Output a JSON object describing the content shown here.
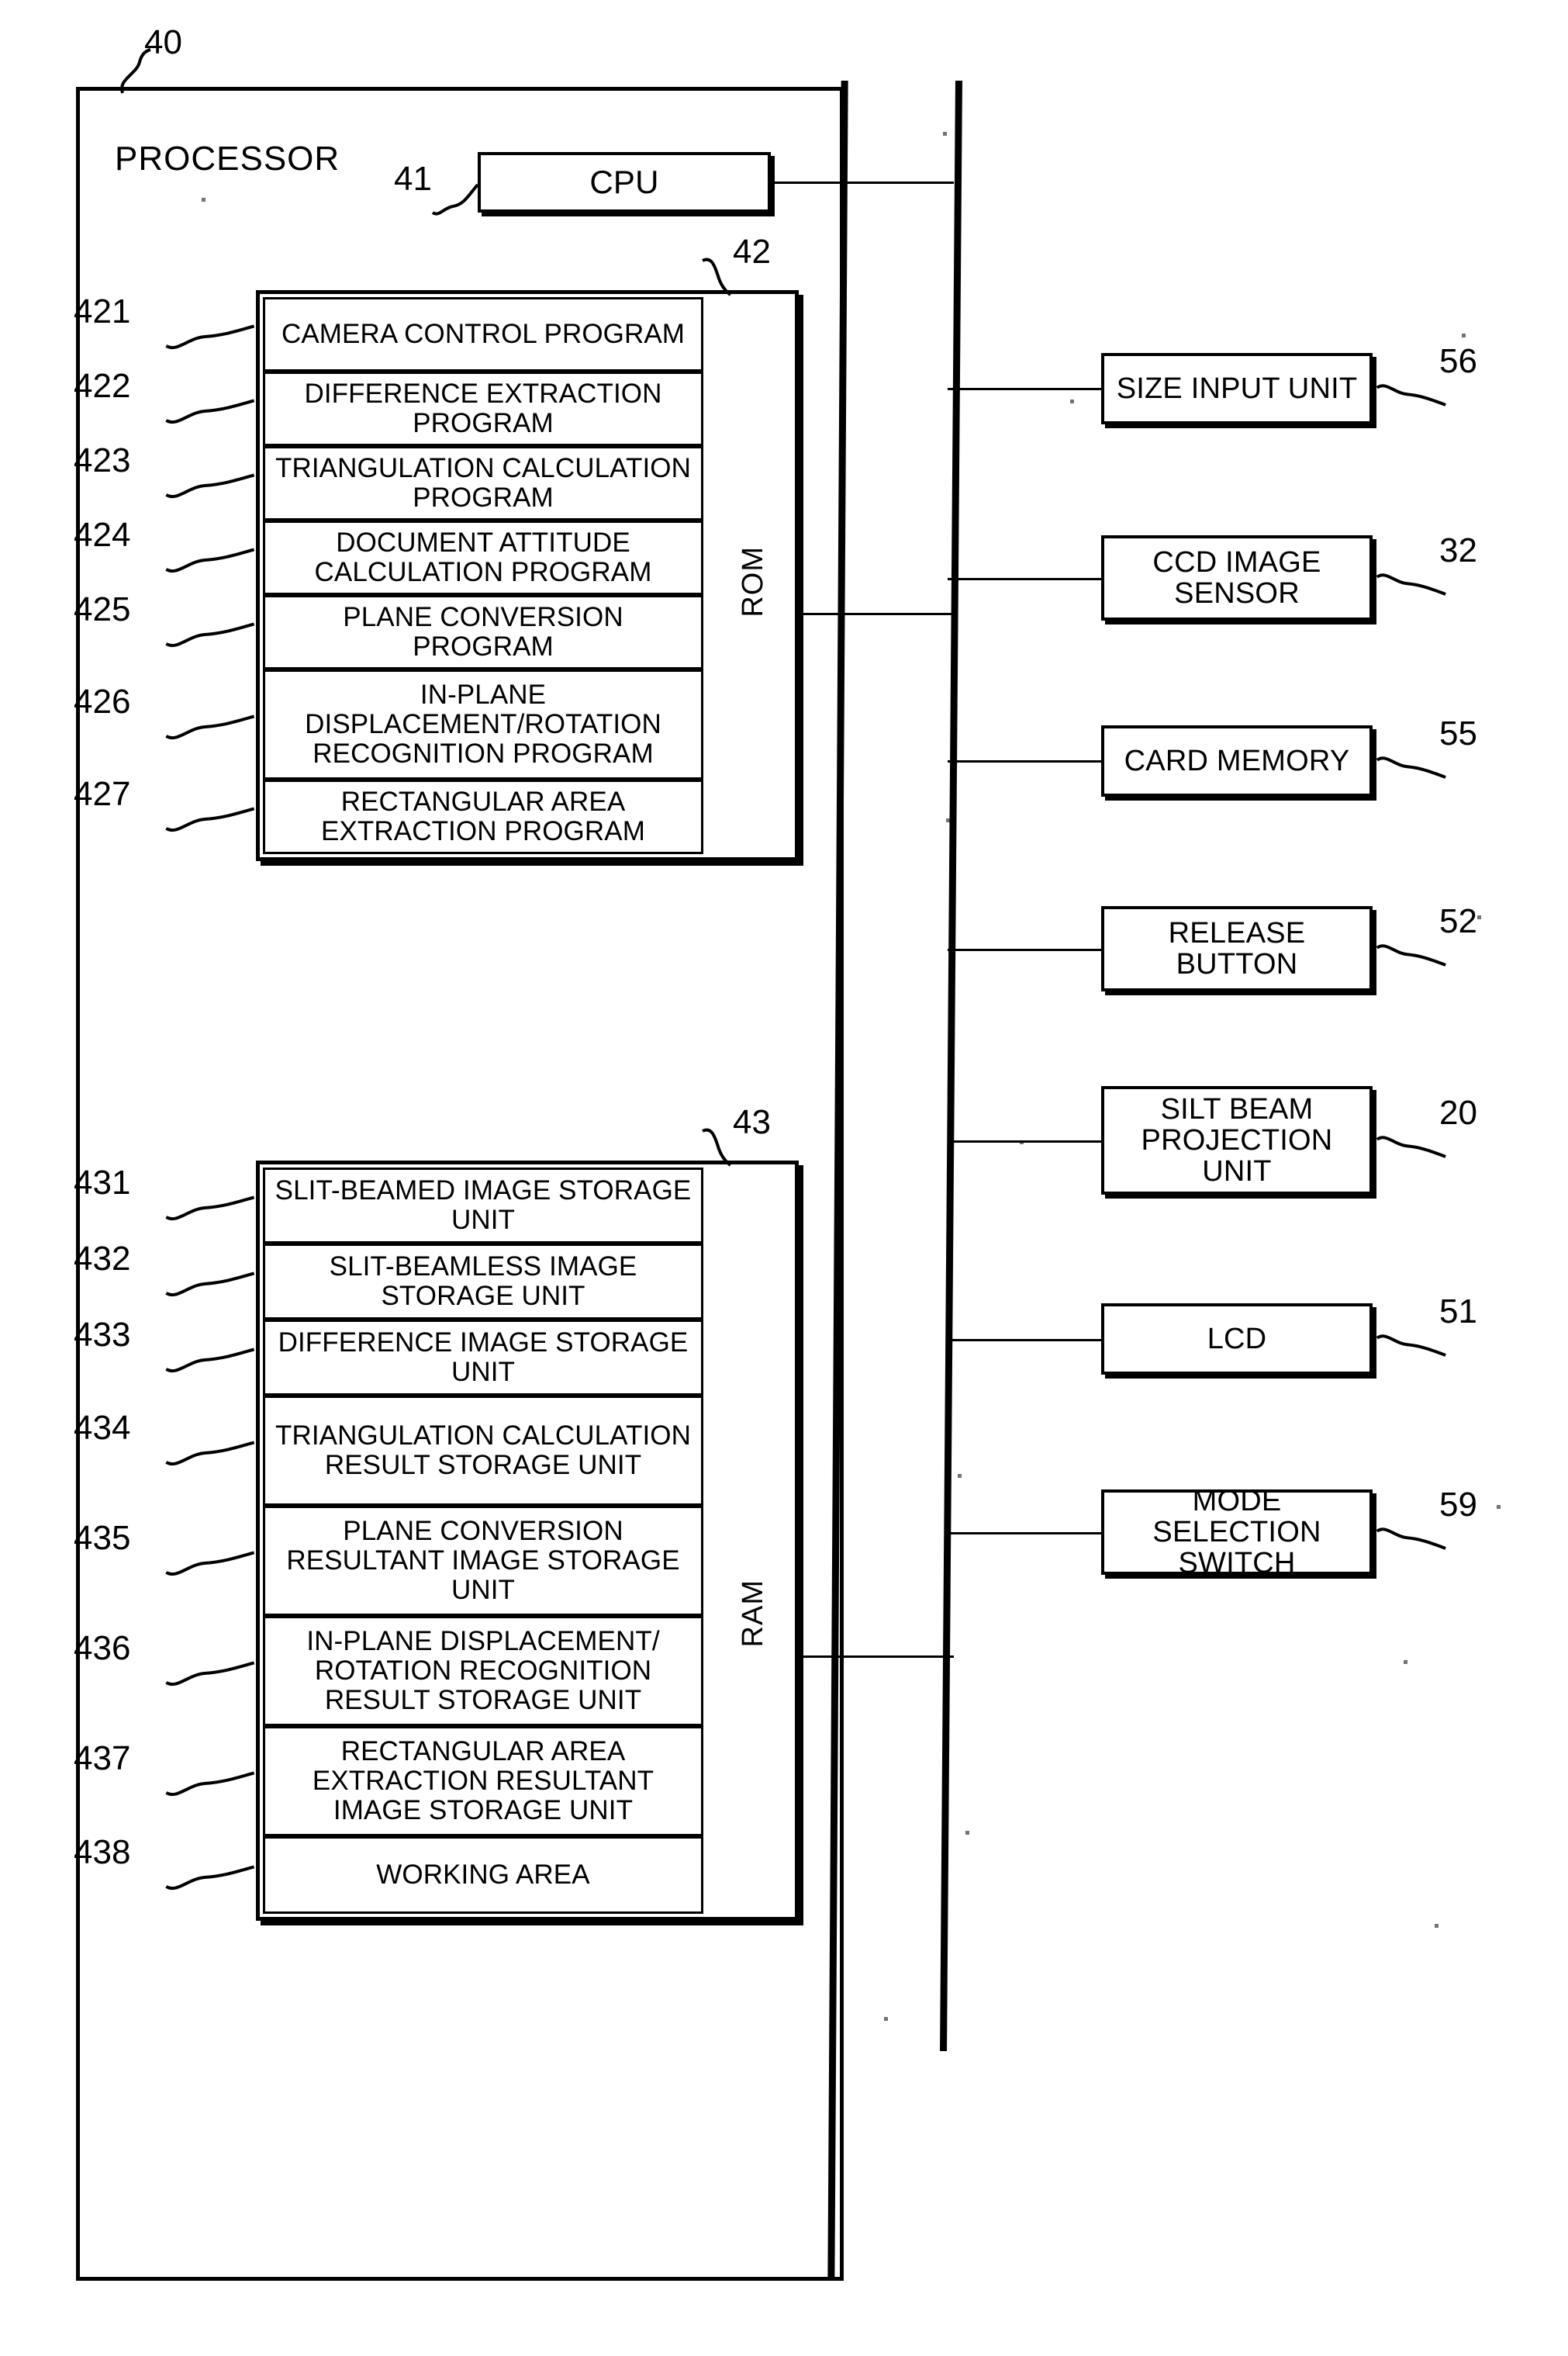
{
  "figure": {
    "type": "patent-block-diagram",
    "processor_label": "PROCESSOR",
    "processor_ref": "40"
  },
  "cpu": {
    "label": "CPU",
    "ref": "41"
  },
  "rom": {
    "ref": "42",
    "side_label": "ROM",
    "items": [
      {
        "ref": "421",
        "label": "CAMERA CONTROL PROGRAM"
      },
      {
        "ref": "422",
        "label": "DIFFERENCE EXTRACTION PROGRAM"
      },
      {
        "ref": "423",
        "label": "TRIANGULATION CALCULATION PROGRAM"
      },
      {
        "ref": "424",
        "label": "DOCUMENT ATTITUDE CALCULATION PROGRAM"
      },
      {
        "ref": "425",
        "label": "PLANE CONVERSION PROGRAM"
      },
      {
        "ref": "426",
        "label": "IN-PLANE DISPLACEMENT/ROTATION RECOGNITION PROGRAM"
      },
      {
        "ref": "427",
        "label": "RECTANGULAR AREA EXTRACTION PROGRAM"
      }
    ]
  },
  "ram": {
    "ref": "43",
    "side_label": "RAM",
    "items": [
      {
        "ref": "431",
        "label": "SLIT-BEAMED IMAGE STORAGE UNIT"
      },
      {
        "ref": "432",
        "label": "SLIT-BEAMLESS IMAGE STORAGE UNIT"
      },
      {
        "ref": "433",
        "label": "DIFFERENCE IMAGE STORAGE UNIT"
      },
      {
        "ref": "434",
        "label": "TRIANGULATION CALCULATION RESULT STORAGE UNIT"
      },
      {
        "ref": "435",
        "label": "PLANE CONVERSION RESULTANT IMAGE STORAGE UNIT"
      },
      {
        "ref": "436",
        "label": "IN-PLANE DISPLACEMENT/ ROTATION RECOGNITION RESULT STORAGE UNIT"
      },
      {
        "ref": "437",
        "label": "RECTANGULAR AREA EXTRACTION RESULTANT IMAGE STORAGE UNIT"
      },
      {
        "ref": "438",
        "label": "WORKING AREA"
      }
    ]
  },
  "peripherals": [
    {
      "ref": "56",
      "label": "SIZE INPUT UNIT"
    },
    {
      "ref": "32",
      "label": "CCD IMAGE SENSOR"
    },
    {
      "ref": "55",
      "label": "CARD MEMORY"
    },
    {
      "ref": "52",
      "label": "RELEASE BUTTON"
    },
    {
      "ref": "20",
      "label": "SILT BEAM PROJECTION UNIT"
    },
    {
      "ref": "51",
      "label": "LCD"
    },
    {
      "ref": "59",
      "label": "MODE SELECTION SWITCH"
    }
  ],
  "colors": {
    "ink": "#000000",
    "paper": "#ffffff"
  }
}
